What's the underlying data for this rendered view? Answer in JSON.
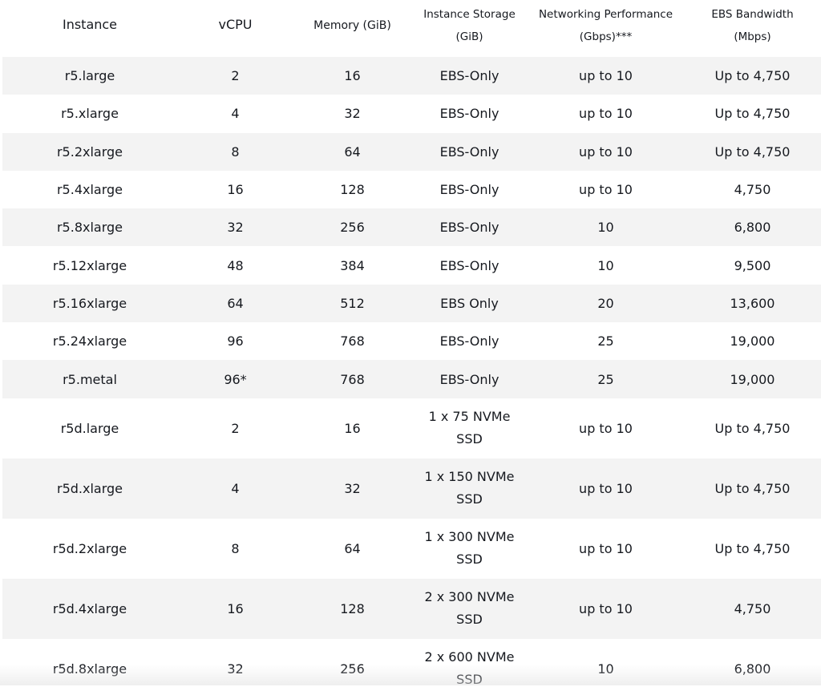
{
  "table": {
    "headers": [
      {
        "line1": "Instance",
        "line2": ""
      },
      {
        "line1": "vCPU",
        "line2": ""
      },
      {
        "line1": "Memory (GiB)",
        "line2": ""
      },
      {
        "line1": "Instance Storage",
        "line2": "(GiB)"
      },
      {
        "line1": "Networking Performance",
        "line2": "(Gbps)***"
      },
      {
        "line1": "EBS Bandwidth",
        "line2": "(Mbps)"
      }
    ],
    "rows": [
      {
        "instance": "r5.large",
        "vcpu": "2",
        "memory": "16",
        "storage1": "EBS-Only",
        "storage2": "",
        "network": "up to 10",
        "ebs": "Up to 4,750"
      },
      {
        "instance": "r5.xlarge",
        "vcpu": "4",
        "memory": "32",
        "storage1": "EBS-Only",
        "storage2": "",
        "network": "up to 10",
        "ebs": "Up to 4,750"
      },
      {
        "instance": "r5.2xlarge",
        "vcpu": "8",
        "memory": "64",
        "storage1": "EBS-Only",
        "storage2": "",
        "network": "up to 10",
        "ebs": "Up to 4,750"
      },
      {
        "instance": "r5.4xlarge",
        "vcpu": "16",
        "memory": "128",
        "storage1": "EBS-Only",
        "storage2": "",
        "network": "up to 10",
        "ebs": "4,750"
      },
      {
        "instance": "r5.8xlarge",
        "vcpu": "32",
        "memory": "256",
        "storage1": "EBS-Only",
        "storage2": "",
        "network": "10",
        "ebs": "6,800"
      },
      {
        "instance": "r5.12xlarge",
        "vcpu": "48",
        "memory": "384",
        "storage1": "EBS-Only",
        "storage2": "",
        "network": "10",
        "ebs": "9,500"
      },
      {
        "instance": "r5.16xlarge",
        "vcpu": "64",
        "memory": "512",
        "storage1": "EBS Only",
        "storage2": "",
        "network": "20",
        "ebs": "13,600"
      },
      {
        "instance": "r5.24xlarge",
        "vcpu": "96",
        "memory": "768",
        "storage1": "EBS-Only",
        "storage2": "",
        "network": "25",
        "ebs": "19,000"
      },
      {
        "instance": "r5.metal",
        "vcpu": "96*",
        "memory": "768",
        "storage1": "EBS-Only",
        "storage2": "",
        "network": "25",
        "ebs": "19,000"
      },
      {
        "instance": "r5d.large",
        "vcpu": "2",
        "memory": "16",
        "storage1": "1 x 75 NVMe",
        "storage2": "SSD",
        "network": "up to 10",
        "ebs": "Up to 4,750"
      },
      {
        "instance": "r5d.xlarge",
        "vcpu": "4",
        "memory": "32",
        "storage1": "1 x 150 NVMe",
        "storage2": "SSD",
        "network": "up to 10",
        "ebs": "Up to 4,750"
      },
      {
        "instance": "r5d.2xlarge",
        "vcpu": "8",
        "memory": "64",
        "storage1": "1 x 300 NVMe",
        "storage2": "SSD",
        "network": "up to 10",
        "ebs": "Up to 4,750"
      },
      {
        "instance": "r5d.4xlarge",
        "vcpu": "16",
        "memory": "128",
        "storage1": "2 x 300 NVMe",
        "storage2": "SSD",
        "network": "up to 10",
        "ebs": "4,750"
      },
      {
        "instance": "r5d.8xlarge",
        "vcpu": "32",
        "memory": "256",
        "storage1": "2 x 600 NVMe",
        "storage2": "SSD",
        "network": "10",
        "ebs": "6,800"
      }
    ]
  },
  "colors": {
    "text": "#16191f",
    "row_shade": "#f3f3f3",
    "background": "#ffffff"
  }
}
